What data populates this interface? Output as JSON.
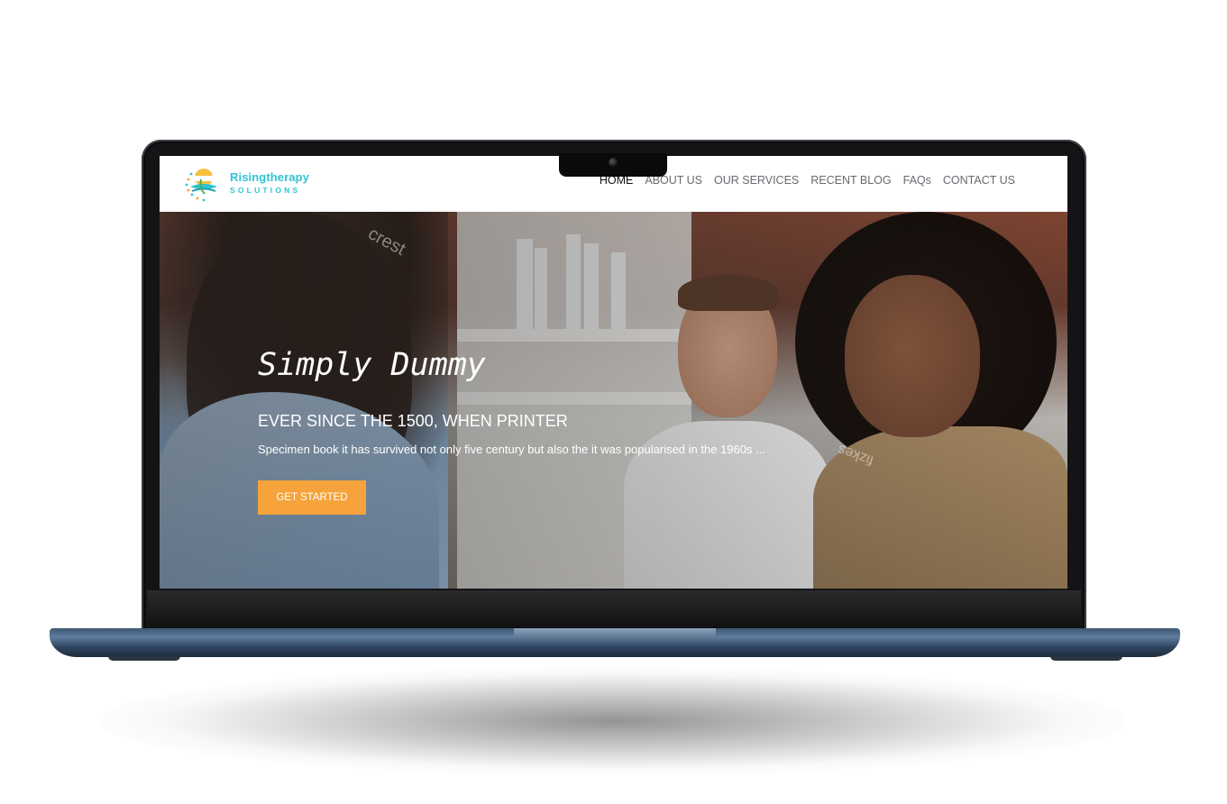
{
  "site": {
    "logo": {
      "name": "Risingtherapy",
      "sub": "SOLUTIONS"
    },
    "nav": [
      {
        "label": "HOME",
        "active": true
      },
      {
        "label": "ABOUT US",
        "active": false
      },
      {
        "label": "OUR SERVICES",
        "active": false
      },
      {
        "label": "RECENT BLOG",
        "active": false
      },
      {
        "label": "FAQs",
        "active": false
      },
      {
        "label": "CONTACT US",
        "active": false
      }
    ],
    "hero": {
      "title": "Simply Dummy",
      "subtitle": "EVER SINCE THE 1500, WHEN PRINTER",
      "text": "Specimen book it has survived not only five century but also the it was popularised in the 1960s ...",
      "cta_label": "GET STARTED"
    },
    "watermarks": [
      "crest",
      "fizkes"
    ]
  },
  "colors": {
    "accent": "#f5a33a",
    "brand": "#2ec4d6",
    "nav_text": "#666a6f",
    "nav_active": "#111111"
  },
  "icons": [
    "logo-sun-icon",
    "camera-icon"
  ]
}
